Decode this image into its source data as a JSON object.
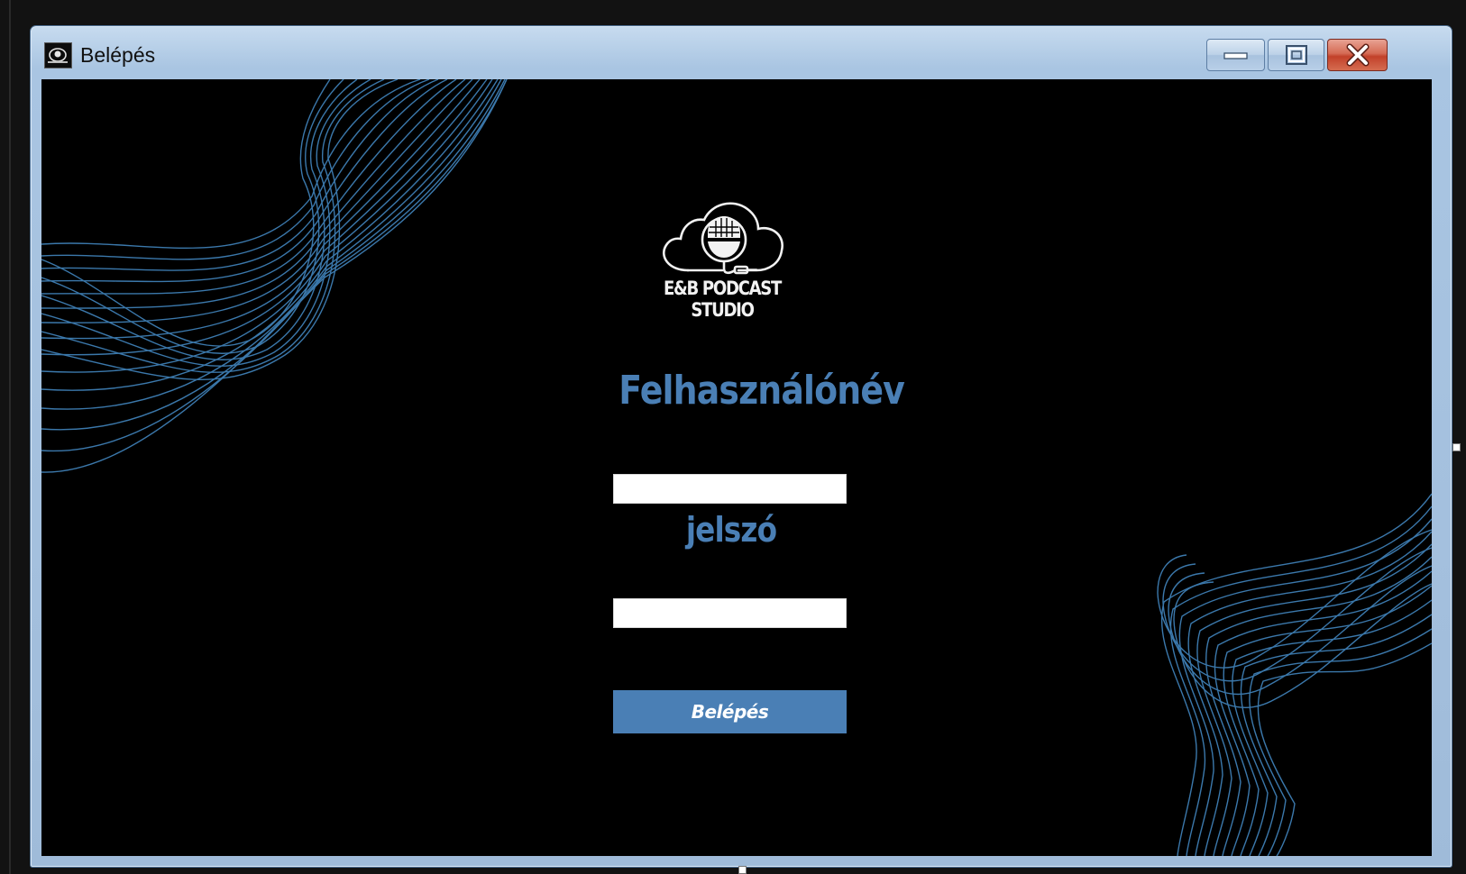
{
  "window": {
    "title": "Belépés",
    "app_icon": "microphone-app-icon",
    "controls": {
      "minimize_icon": "minimize-icon",
      "maximize_icon": "maximize-icon",
      "close_icon": "close-icon"
    }
  },
  "brand": {
    "name": "E&B PODCAST STUDIO",
    "logo_icon": "cloud-microphone-logo"
  },
  "form": {
    "username_label": "Felhasználónév",
    "username_value": "",
    "password_label": "jelszó",
    "password_value": "",
    "submit_label": "Belépés"
  },
  "colors": {
    "accent": "#4a7fb5",
    "background": "#000000",
    "wave": "#3f7fb5",
    "titlebar": "#a9c5e2",
    "close_button": "#c2412a"
  }
}
